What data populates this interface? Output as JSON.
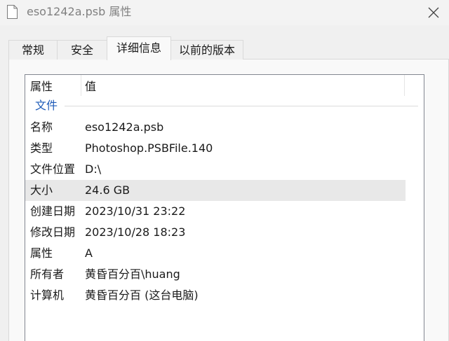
{
  "window": {
    "title": "eso1242a.psb 属性"
  },
  "tabs": [
    {
      "label": "常规"
    },
    {
      "label": "安全"
    },
    {
      "label": "详细信息"
    },
    {
      "label": "以前的版本"
    }
  ],
  "list": {
    "col_property": "属性",
    "col_value": "值",
    "group": "文件",
    "rows": [
      {
        "name": "名称",
        "value": "eso1242a.psb"
      },
      {
        "name": "类型",
        "value": "Photoshop.PSBFile.140"
      },
      {
        "name": "文件位置",
        "value": "D:\\"
      },
      {
        "name": "大小",
        "value": "24.6 GB"
      },
      {
        "name": "创建日期",
        "value": "2023/10/31 23:22"
      },
      {
        "name": "修改日期",
        "value": "2023/10/28 18:23"
      },
      {
        "name": "属性",
        "value": "A"
      },
      {
        "name": "所有者",
        "value": "黄昏百分百\\huang"
      },
      {
        "name": "计算机",
        "value": "黄昏百分百 (这台电脑)"
      }
    ]
  },
  "icons": {
    "file": "file-icon",
    "close": "close-icon"
  },
  "colors": {
    "group_accent": "#1e5bb8",
    "selected_row": "#e8e8e8"
  }
}
